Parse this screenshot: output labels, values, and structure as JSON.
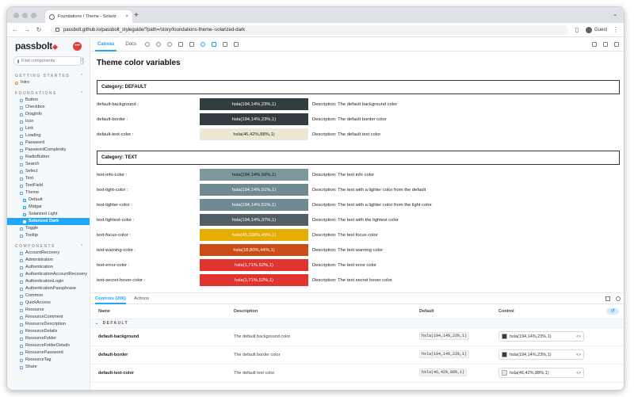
{
  "browser": {
    "tab_title": "Foundations / Theme - Solariz",
    "tab_close": "×",
    "new_tab": "+",
    "url": "passbolt.github.io/passbolt_styleguide/?path=/story/foundations-theme--solarized-dark",
    "profile": "Guest"
  },
  "sidebar": {
    "logo": "passbolt",
    "search_placeholder": "Find components",
    "search_shortcut": "/",
    "getting_started_title": "GETTING STARTED",
    "intro": "Intro",
    "foundations_title": "FOUNDATIONS",
    "foundations": [
      "Button",
      "Checkbox",
      "DragInfo",
      "Icon",
      "Link",
      "Loading",
      "Password",
      "PasswordComplexity",
      "RadioButton",
      "Search",
      "Select",
      "Text",
      "TextField",
      "Theme"
    ],
    "theme_children": [
      "Default",
      "Midgar",
      "Solarized Light",
      "Solarized Dark"
    ],
    "foundations_after": [
      "Toggle",
      "Tooltip"
    ],
    "components_title": "COMPONENTS",
    "components": [
      "AccountRecovery",
      "Administration",
      "Authentication",
      "AuthenticationAccountRecovery",
      "AuthenticationLogin",
      "AuthenticationPassphrase",
      "Common",
      "QuickAccess",
      "Resource",
      "ResourceComment",
      "ResourceDescription",
      "ResourceDetails",
      "ResourceFolder",
      "ResourceFolderDetails",
      "ResourcePassword",
      "ResourceTag",
      "Share"
    ]
  },
  "toolbar": {
    "canvas_label": "Canvas",
    "docs_label": "Docs"
  },
  "canvas": {
    "page_title": "Theme color variables",
    "categories": [
      {
        "label": "Category: DEFAULT",
        "rows": [
          {
            "name": "default-background :",
            "value": "hsla(194,14%,23%,1)",
            "bg": "#333d41",
            "fg": "#ffffff",
            "desc": "Description: The default background color"
          },
          {
            "name": "default-border :",
            "value": "hsla(194,14%,23%,1)",
            "bg": "#333d41",
            "fg": "#ffffff",
            "desc": "Description: The default border color"
          },
          {
            "name": "default-text-color :",
            "value": "hsla(46,42%,88%,1)",
            "bg": "#ede7d6",
            "fg": "#222222",
            "desc": "Description: The default text color"
          }
        ]
      },
      {
        "label": "Category: TEXT",
        "rows": [
          {
            "name": "text-info-color :",
            "value": "hsla(194,14%,56%,1)",
            "bg": "#7d979f",
            "fg": "#111111",
            "desc": "Description: The text info color"
          },
          {
            "name": "text-light-color :",
            "value": "hsla(194,14%,51%,1)",
            "bg": "#708a93",
            "fg": "#ffffff",
            "desc": "Description: The text with a lighter color from the default"
          },
          {
            "name": "text-lighter-color :",
            "value": "hsla(194,14%,51%,1)",
            "bg": "#708a93",
            "fg": "#ffffff",
            "desc": "Description: The text with a lighter color from the light color"
          },
          {
            "name": "text-lightest-color :",
            "value": "hsla(194,14%,37%,1)",
            "bg": "#515f65",
            "fg": "#ffffff",
            "desc": "Description: The text with the lightest color"
          },
          {
            "name": "text-focus-color :",
            "value": "hsla(45,100%,45%,1)",
            "bg": "#e6ad00",
            "fg": "#ffffff",
            "desc": "Description: The text focus color"
          },
          {
            "name": "text-warning-color :",
            "value": "hsla(18,80%,44%,1)",
            "bg": "#c94d16",
            "fg": "#ffffff",
            "desc": "Description: The text warning color"
          },
          {
            "name": "text-error-color :",
            "value": "hsla(1,71%,52%,1)",
            "bg": "#df3432",
            "fg": "#ffffff",
            "desc": "Description: The text error color"
          },
          {
            "name": "text-secret-hover-color :",
            "value": "hsla(1,71%,52%,1)",
            "bg": "#df3432",
            "fg": "#ffffff",
            "desc": "Description: The text secret hover color"
          }
        ]
      }
    ]
  },
  "panel": {
    "tab_controls": "Controls (206)",
    "tab_actions": "Actions",
    "col_name": "Name",
    "col_description": "Description",
    "col_default": "Default",
    "col_control": "Control",
    "group_label": "DEFAULT",
    "rows": [
      {
        "name": "default-background",
        "desc": "The default background color",
        "default": "hsla(194,14%,23%,1)",
        "control": "hsla(194,14%,23%,1)",
        "swatch": "#333d41"
      },
      {
        "name": "default-border",
        "desc": "The default border color",
        "default": "hsla(194,14%,23%,1)",
        "control": "hsla(194,14%,23%,1)",
        "swatch": "#333d41"
      },
      {
        "name": "default-text-color",
        "desc": "The default text color",
        "default": "hsla(46,42%,88%,1)",
        "control": "hsla(46,42%,88%,1)",
        "swatch": "#ede7d6"
      }
    ]
  },
  "colors": {
    "accent": "#1ea7fd",
    "brand_red": "#e03d3d"
  }
}
